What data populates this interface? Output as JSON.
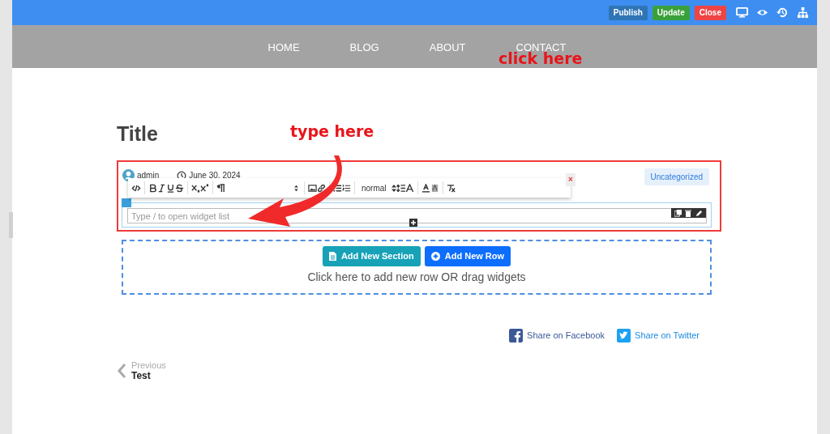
{
  "top_bar": {
    "buttons": [
      {
        "label": "Publish",
        "kind": "publish"
      },
      {
        "label": "Update",
        "kind": "update"
      },
      {
        "label": "Close",
        "kind": "close"
      }
    ]
  },
  "nav": {
    "items": [
      "HOME",
      "BLOG",
      "ABOUT",
      "CONTACT"
    ]
  },
  "post": {
    "title": "Title",
    "author": "admin",
    "date": "June 30, 2024",
    "category": "Uncategorized"
  },
  "toolbar": {
    "select_value": "normal",
    "close": "×"
  },
  "editor": {
    "placeholder": "Type / to open widget list"
  },
  "dropzone": {
    "buttons": [
      {
        "label": "Add New Section",
        "kind": "section"
      },
      {
        "label": "Add New Row",
        "kind": "row"
      }
    ],
    "hint": "Click here to add new row OR drag widgets"
  },
  "share": [
    {
      "label": "Share on Facebook",
      "kind": "facebook"
    },
    {
      "label": "Share on Twitter",
      "kind": "twitter"
    }
  ],
  "prev": {
    "label": "Previous",
    "title": "Test"
  },
  "annotations": [
    {
      "kind": "text",
      "text": "click here"
    },
    {
      "kind": "text",
      "text": "type here"
    },
    {
      "kind": "arrow"
    },
    {
      "kind": "box"
    }
  ]
}
